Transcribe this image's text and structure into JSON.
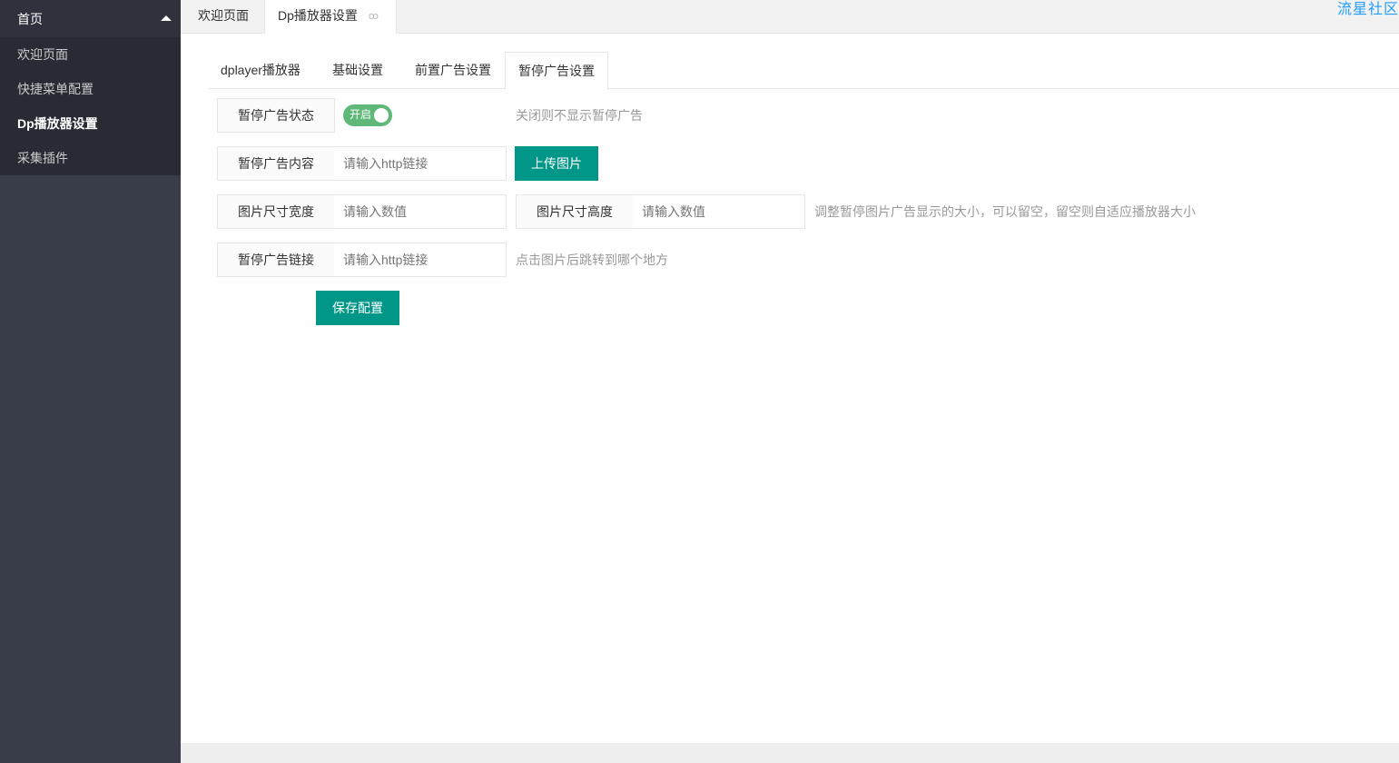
{
  "sidebar": {
    "group_title": "首页",
    "items": [
      {
        "label": "欢迎页面",
        "active": false
      },
      {
        "label": "快捷菜单配置",
        "active": false
      },
      {
        "label": "Dp播放器设置",
        "active": true
      },
      {
        "label": "采集插件",
        "active": false
      }
    ]
  },
  "tabs": {
    "items": [
      "欢迎页面",
      "Dp播放器设置"
    ],
    "close_icon": "ꝏ"
  },
  "brand": "流星社区",
  "subtabs": [
    "dplayer播放器",
    "基础设置",
    "前置广告设置",
    "暂停广告设置"
  ],
  "form": {
    "status_label": "暂停广告状态",
    "status_toggle": "开启",
    "status_hint": "关闭则不显示暂停广告",
    "content_label": "暂停广告内容",
    "content_placeholder": "请输入http链接",
    "upload_button": "上传图片",
    "width_label": "图片尺寸宽度",
    "width_placeholder": "请输入数值",
    "height_label": "图片尺寸高度",
    "height_placeholder": "请输入数值",
    "size_hint": "调整暂停图片广告显示的大小，可以留空，留空则自适应播放器大小",
    "link_label": "暂停广告链接",
    "link_placeholder": "请输入http链接",
    "link_hint": "点击图片后跳转到哪个地方",
    "save_button": "保存配置"
  },
  "colors": {
    "sidebar_bg": "#393d49",
    "primary": "#009688",
    "toggle_on": "#5fb878",
    "brand": "#1e9fff"
  }
}
